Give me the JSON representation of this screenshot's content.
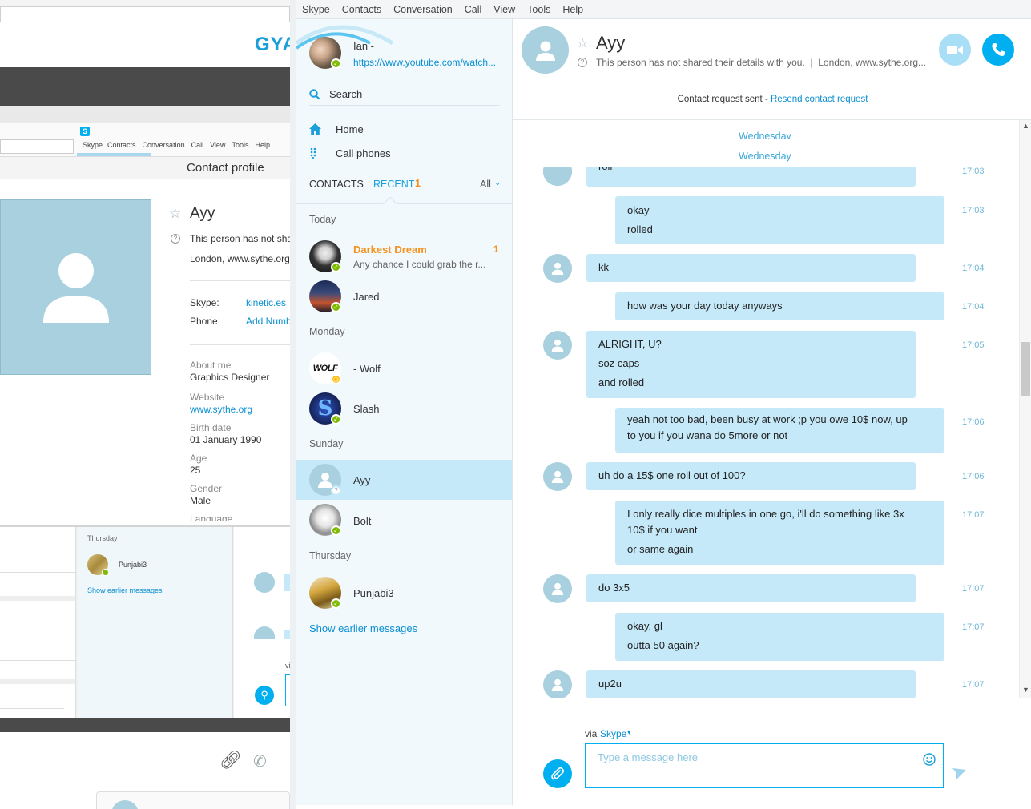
{
  "background_window": {
    "brand_partial": "GYA",
    "mini_menu": [
      "Skype",
      "Contacts",
      "Conversation",
      "Call",
      "View",
      "Tools",
      "Help"
    ],
    "section_title": "Contact profile",
    "profile": {
      "name": "Ayy",
      "not_shared": "This person has not sha",
      "location": "London, www.sythe.org",
      "skype_label": "Skype:",
      "skype_value": "kinetic.es",
      "phone_label": "Phone:",
      "phone_value": "Add Numb",
      "about_label": "About me",
      "about_value": "Graphics Designer",
      "website_label": "Website",
      "website_value": "www.sythe.org",
      "birth_label": "Birth date",
      "birth_value": "01 January 1990",
      "age_label": "Age",
      "age_value": "25",
      "gender_label": "Gender",
      "gender_value": "Male",
      "language_label": "Language"
    },
    "mini_recent": {
      "day": "Thursday",
      "contact": "Punjabi3",
      "show_earlier": "Show earlier messages"
    },
    "vi_partial": "vi"
  },
  "skype": {
    "menu": [
      "Skype",
      "Contacts",
      "Conversation",
      "Call",
      "View",
      "Tools",
      "Help"
    ],
    "user": {
      "name": "Ian -",
      "mood": "https://www.youtube.com/watch..."
    },
    "search_label": "Search",
    "nav": {
      "home": "Home",
      "call_phones": "Call phones"
    },
    "tabs": {
      "contacts": "CONTACTS",
      "recent": "RECENT",
      "recent_count": "1",
      "filter": "All"
    },
    "days": {
      "today": "Today",
      "monday": "Monday",
      "sunday": "Sunday",
      "thursday": "Thursday"
    },
    "contacts": {
      "darkest": {
        "name": "Darkest Dream",
        "preview": "Any chance I could grab the r...",
        "badge": "1"
      },
      "jared": {
        "name": "Jared"
      },
      "wolf": {
        "name": "- Wolf",
        "avatar_text": "WOLF"
      },
      "slash": {
        "name": "Slash",
        "avatar_text": "S"
      },
      "ayy": {
        "name": "Ayy"
      },
      "bolt": {
        "name": "Bolt"
      },
      "punjabi": {
        "name": "Punjabi3"
      }
    },
    "show_earlier": "Show earlier messages",
    "colors": {
      "accent": "#00aff0",
      "bubble": "#c5e9f9",
      "selected": "#c5e9f9",
      "unread": "#f6921e",
      "online": "#7dba00"
    }
  },
  "chat": {
    "name": "Ayy",
    "subtitle": "This person has not shared their details with you.  |  London, www.sythe.org...",
    "request_text": "Contact request sent - ",
    "resend_link": "Resend contact request",
    "day_divider": "Wednesday",
    "messages": {
      "m0": {
        "lines": [
          "roll"
        ],
        "time": "17:03"
      },
      "m1": {
        "lines": [
          "okay",
          "rolled"
        ],
        "time": "17:03"
      },
      "m2": {
        "lines": [
          "kk"
        ],
        "time": "17:04"
      },
      "m3": {
        "lines": [
          "how was your day today anyways"
        ],
        "time": "17:04"
      },
      "m4": {
        "lines": [
          "ALRIGHT, U?",
          "soz caps",
          "and rolled"
        ],
        "time": "17:05"
      },
      "m5": {
        "lines": [
          "yeah not too bad, been busy at work ;p you owe 10$ now, up",
          "to you if you wana do 5more or not"
        ],
        "time": "17:06"
      },
      "m6": {
        "lines": [
          "uh do a 15$ one roll out of 100?"
        ],
        "time": "17:06"
      },
      "m7": {
        "lines": [
          "I only really dice multiples in one go, i'll do something like 3x",
          "10$ if you want",
          "or same again"
        ],
        "time": "17:07"
      },
      "m8": {
        "lines": [
          "do 3x5"
        ],
        "time": "17:07"
      },
      "m9": {
        "lines": [
          "okay, gl",
          "outta 50 again?"
        ],
        "time": "17:07"
      },
      "m10": {
        "lines": [
          "up2u"
        ],
        "time": "17:07"
      }
    },
    "via_label": "via",
    "via_service": "Skype",
    "input_placeholder": "Type a message here"
  }
}
